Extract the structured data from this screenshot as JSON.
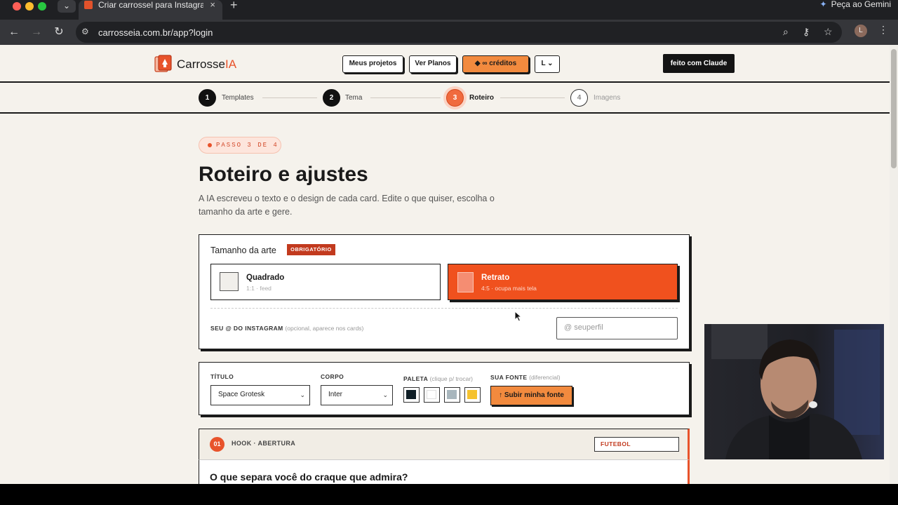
{
  "browser": {
    "tab_title": "Criar carrossel para Instagram",
    "tab_close": "×",
    "new_tab": "+",
    "tab_dropdown": "⌄",
    "gemini_label": "Peça ao Gemini",
    "url": "carrosseia.com.br/app?login",
    "profile_initial": "L",
    "back_icon": "←",
    "forward_icon": "→",
    "reload_icon": "↻",
    "site_info_icon": "⚙",
    "zoom_icon": "⌕",
    "key_icon": "⚷",
    "star_icon": "☆",
    "menu_icon": "⋮",
    "traffic_colors": [
      "#ff5f57",
      "#febc2e",
      "#28c840"
    ]
  },
  "header": {
    "logo_text_main": "Carrosse",
    "logo_text_accent": "IA",
    "my_projects": "Meus projetos",
    "see_plans": "Ver Planos",
    "credits": "◆ ∞ créditos",
    "lang": "L ⌄",
    "made_with": "feito com Claude"
  },
  "stepper": {
    "steps": [
      {
        "num": "1",
        "label": "Templates"
      },
      {
        "num": "2",
        "label": "Tema"
      },
      {
        "num": "3",
        "label": "Roteiro"
      },
      {
        "num": "4",
        "label": "Imagens"
      }
    ]
  },
  "intro": {
    "badge": "PASSO 3 DE 4",
    "title": "Roteiro e ajustes",
    "subtitle": "A IA escreveu o texto e o design de cada card. Edite o que quiser, escolha o tamanho da arte e gere."
  },
  "size_card": {
    "title": "Tamanho da arte",
    "required": "OBRIGATÓRIO",
    "options": [
      {
        "title": "Quadrado",
        "meta": "1:1 · feed",
        "selected": false
      },
      {
        "title": "Retrato",
        "meta": "4:5 · ocupa mais tela",
        "selected": true
      }
    ],
    "ig_label": "SEU @ DO INSTAGRAM",
    "ig_hint": "(opcional, aparece nos cards)",
    "ig_placeholder": "@  seuperfil"
  },
  "style_card": {
    "title_label": "TÍTULO",
    "title_value": "Space Grotesk",
    "body_label": "CORPO",
    "body_value": "Inter",
    "palette_label": "PALETA",
    "palette_hint": "(clique p/ trocar)",
    "palette_colors": [
      "#0f1e26",
      "#ffffff",
      "#a8b6bd",
      "#f5c22e"
    ],
    "font_label": "SUA FONTE",
    "font_hint": "(diferencial)",
    "upload_label": "↑ Subir minha fonte",
    "chevron": "⌄"
  },
  "slide": {
    "number": "01",
    "label": "HOOK · ABERTURA",
    "tag": "FUTEBOL",
    "headline": "O que separa você do craque que admira?"
  },
  "colors": {
    "accent": "#e8532b",
    "background": "#f5f2ec",
    "ink": "#1a1a1a"
  }
}
